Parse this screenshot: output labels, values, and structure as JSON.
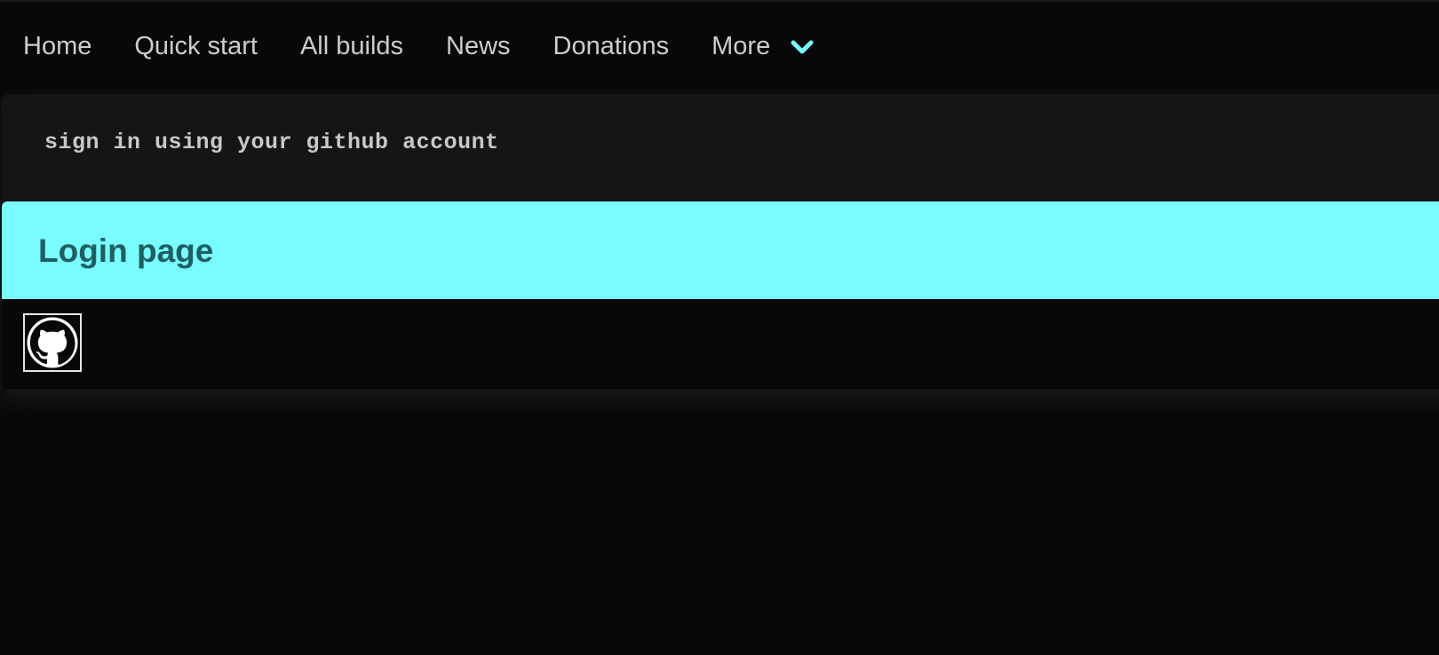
{
  "nav": {
    "items": [
      {
        "label": "Home"
      },
      {
        "label": "Quick start"
      },
      {
        "label": "All builds"
      },
      {
        "label": "News"
      },
      {
        "label": "Donations"
      }
    ],
    "more_label": "More",
    "more_icon": "chevron-down-icon"
  },
  "card": {
    "notice": "sign in using your github account",
    "title": "Login page",
    "login_icon": "github-icon"
  },
  "colors": {
    "accent": "#78fcff",
    "header_text": "#1f5f62",
    "background": "#080808",
    "notice_background": "#151515",
    "nav_text": "#cdcdcd"
  }
}
